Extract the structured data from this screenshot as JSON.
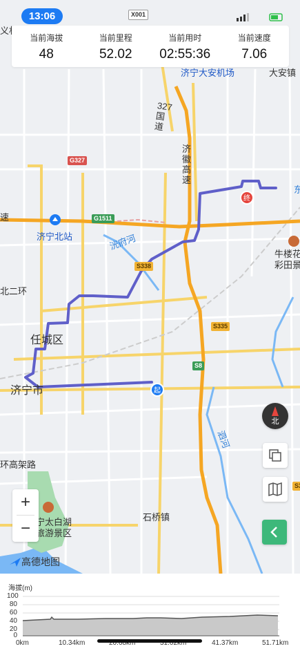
{
  "status_bar": {
    "time": "13:06"
  },
  "stats": [
    {
      "label": "当前海拔",
      "value": "48"
    },
    {
      "label": "当前里程",
      "value": "52.02"
    },
    {
      "label": "当前用时",
      "value": "02:55:36"
    },
    {
      "label": "当前速度",
      "value": "7.06"
    }
  ],
  "map": {
    "labels": {
      "airport": "济宁大安机场",
      "daan": "大安镇",
      "yi": "义村",
      "x001": "X001",
      "g327_road": "327国道",
      "jiwei": "济徽高速",
      "jining_north": "济宁北站",
      "sufu": "洸府河",
      "beierhuan": "北二环",
      "rencheng": "任城区",
      "jining": "济宁市",
      "huangaolu": "环高架路",
      "taibaihu": "宁太白湖旅游景区",
      "shiqiao": "石桥镇",
      "siriver": "泗河",
      "niulou": "牛楼花彩田景",
      "su": "速",
      "tail_e": "东"
    },
    "badges": {
      "g327": "G327",
      "g1511": "G1511",
      "s338": "S338",
      "s335": "S335",
      "s8": "S8",
      "s3": "S3"
    },
    "markers": {
      "start": "起",
      "end": "终"
    },
    "compass": "北",
    "logo": "高德地图",
    "colors": {
      "route": "#5f5fc9",
      "highway": "#f5a623",
      "water": "#7ab8f5",
      "park": "#a8dbb0"
    }
  },
  "elevation": {
    "title": "海拔(m)",
    "y_ticks": [
      "100",
      "80",
      "60",
      "40",
      "20",
      "0"
    ],
    "x_ticks": [
      "0km",
      "10.34km",
      "20.68km",
      "31.02km",
      "41.37km",
      "51.71km"
    ]
  }
}
